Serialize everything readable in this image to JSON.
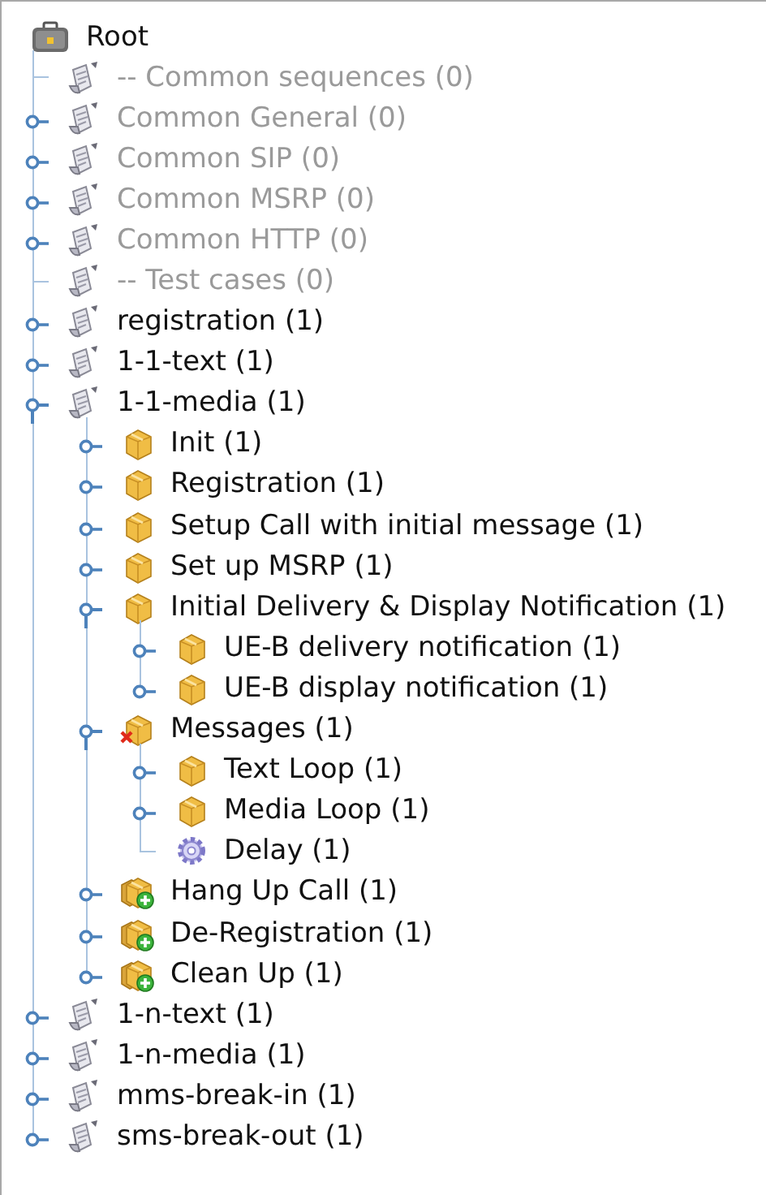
{
  "tree": {
    "root": {
      "label": "Root",
      "kind": "root",
      "children": [
        {
          "label": "-- Common sequences (0)",
          "kind": "scenario",
          "disabled": true
        },
        {
          "label": "Common General (0)",
          "kind": "scenario",
          "expanded": false,
          "disabled": true
        },
        {
          "label": "Common SIP (0)",
          "kind": "scenario",
          "expanded": false,
          "disabled": true
        },
        {
          "label": "Common MSRP (0)",
          "kind": "scenario",
          "expanded": false,
          "disabled": true
        },
        {
          "label": "Common HTTP (0)",
          "kind": "scenario",
          "expanded": false,
          "disabled": true
        },
        {
          "label": "-- Test cases (0)",
          "kind": "scenario",
          "disabled": true
        },
        {
          "label": "registration (1)",
          "kind": "scenario",
          "expanded": false,
          "disabled": false
        },
        {
          "label": "1-1-text (1)",
          "kind": "scenario",
          "expanded": false,
          "disabled": false
        },
        {
          "label": "1-1-media (1)",
          "kind": "scenario",
          "expanded": true,
          "disabled": false,
          "children": [
            {
              "label": "Init (1)",
              "kind": "box",
              "expanded": false,
              "disabled": false
            },
            {
              "label": "Registration (1)",
              "kind": "box",
              "expanded": false,
              "disabled": false
            },
            {
              "label": "Setup Call with initial message (1)",
              "kind": "box",
              "expanded": false,
              "disabled": false
            },
            {
              "label": "Set up MSRP (1)",
              "kind": "box",
              "expanded": false,
              "disabled": false
            },
            {
              "label": "Initial Delivery & Display Notification (1)",
              "kind": "box",
              "expanded": true,
              "disabled": false,
              "children": [
                {
                  "label": "UE-B delivery notification (1)",
                  "kind": "box",
                  "expanded": false,
                  "disabled": false
                },
                {
                  "label": "UE-B display notification (1)",
                  "kind": "box",
                  "expanded": false,
                  "disabled": false
                }
              ]
            },
            {
              "label": "Messages (1)",
              "kind": "box-error",
              "expanded": true,
              "disabled": false,
              "children": [
                {
                  "label": "Text Loop (1)",
                  "kind": "box",
                  "expanded": false,
                  "disabled": false
                },
                {
                  "label": "Media Loop (1)",
                  "kind": "box",
                  "expanded": false,
                  "disabled": false
                },
                {
                  "label": "Delay (1)",
                  "kind": "gear",
                  "disabled": false
                }
              ]
            },
            {
              "label": "Hang Up Call (1)",
              "kind": "box-add",
              "expanded": false,
              "disabled": false
            },
            {
              "label": "De-Registration (1)",
              "kind": "box-add",
              "expanded": false,
              "disabled": false
            },
            {
              "label": "Clean Up (1)",
              "kind": "box-add",
              "expanded": false,
              "disabled": false
            }
          ]
        },
        {
          "label": "1-n-text (1)",
          "kind": "scenario",
          "expanded": false,
          "disabled": false
        },
        {
          "label": "1-n-media (1)",
          "kind": "scenario",
          "expanded": false,
          "disabled": false
        },
        {
          "label": "mms-break-in (1)",
          "kind": "scenario",
          "expanded": false,
          "disabled": false
        },
        {
          "label": "sms-break-out (1)",
          "kind": "scenario",
          "expanded": false,
          "disabled": false
        }
      ]
    }
  }
}
